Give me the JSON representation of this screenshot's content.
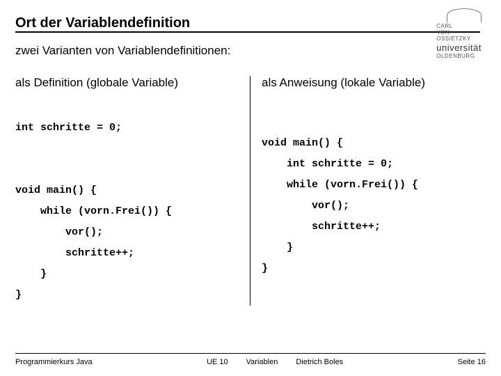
{
  "logo": {
    "line1": "CARL",
    "line2": "VON",
    "line3": "OSSIETZKY",
    "uni": "universität",
    "city": "OLDENBURG"
  },
  "title": "Ort der Variablendefinition",
  "intro": "zwei Varianten von Variablendefinitionen:",
  "left": {
    "heading": "als Definition (globale Variable)",
    "code": "int schritte = 0;\n\n\nvoid main() {\n    while (vorn.Frei()) {\n        vor();\n        schritte++;\n    }\n}"
  },
  "right": {
    "heading": "als Anweisung (lokale Variable)",
    "code": "void main() {\n    int schritte = 0;\n    while (vorn.Frei()) {\n        vor();\n        schritte++;\n    }\n}"
  },
  "footer": {
    "course": "Programmierkurs Java",
    "unit": "UE 10",
    "topic": "Variablen",
    "author": "Dietrich Boles",
    "page": "Seite 16"
  }
}
